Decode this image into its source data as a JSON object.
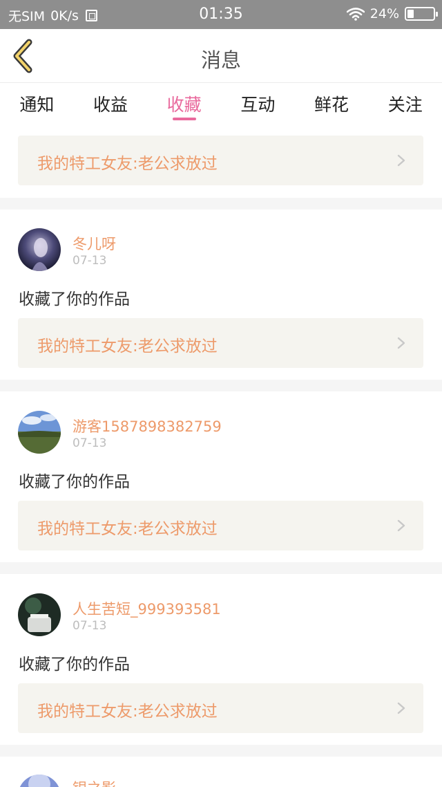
{
  "status": {
    "carrier": "无SIM",
    "speed": "0K/s",
    "time": "01:35",
    "battery_text": "24%",
    "battery_level": 0.24
  },
  "header": {
    "title": "消息"
  },
  "tabs": [
    "通知",
    "收益",
    "收藏",
    "互动",
    "鲜花",
    "关注"
  ],
  "active_tab": "收藏",
  "top_work": {
    "title": "我的特工女友:老公求放过"
  },
  "items": [
    {
      "user": "冬儿呀",
      "date": "07-13",
      "action": "收藏了你的作品",
      "work": "我的特工女友:老公求放过"
    },
    {
      "user": "游客1587898382759",
      "date": "07-13",
      "action": "收藏了你的作品",
      "work": "我的特工女友:老公求放过"
    },
    {
      "user": "人生苦短_999393581",
      "date": "07-13",
      "action": "收藏了你的作品",
      "work": "我的特工女友:老公求放过"
    }
  ],
  "partial_item": {
    "user": "银之影"
  },
  "colors": {
    "accent": "#e96a9d",
    "username": "#ed9a6a",
    "statusbar": "#8e8e8e",
    "card_bg": "#f5f4ef"
  }
}
